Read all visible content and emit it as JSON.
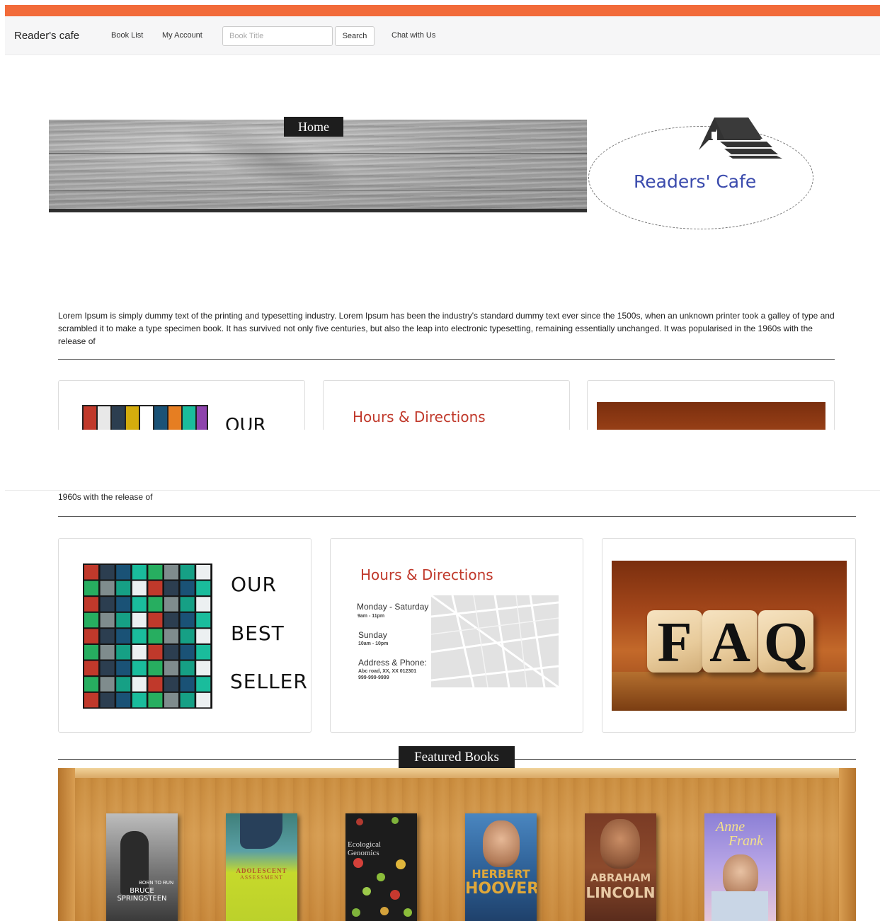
{
  "navbar": {
    "brand": "Reader's cafe",
    "links": {
      "book_list": "Book List",
      "my_account": "My Account",
      "chat": "Chat with Us"
    },
    "search": {
      "placeholder": "Book Title",
      "button": "Search"
    },
    "accent_color": "#f26b3a"
  },
  "hero": {
    "home_label": "Home",
    "logo_text": "Readers' Cafe"
  },
  "intro": {
    "text": "Lorem Ipsum is simply dummy text of the printing and typesetting industry. Lorem Ipsum has been the industry's standard dummy text ever since the 1500s, when an unknown printer took a galley of type and scrambled it to make a type specimen book. It has survived not only five centuries, but also the leap into electronic typesetting, remaining essentially unchanged. It was popularised in the 1960s with the release of",
    "repeated_line": "1960s with the release of"
  },
  "cards": {
    "best_seller": {
      "word1": "OUR",
      "word2": "BEST",
      "word3": "SELLER"
    },
    "hours": {
      "title": "Hours & Directions",
      "weekday_label": "Monday - Saturday",
      "weekday_hours": "9am - 11pm",
      "sunday_label": "Sunday",
      "sunday_hours": "10am - 10pm",
      "address_label": "Address & Phone:",
      "address": "Abc road, XX, XX 012301",
      "phone": "999-999-9999"
    },
    "faq": {
      "l1": "F",
      "l2": "A",
      "l3": "Q"
    }
  },
  "featured": {
    "label": "Featured Books",
    "books": [
      {
        "title": "BORN TO RUN",
        "subtitle": "BRUCE SPRINGSTEEN"
      },
      {
        "title": "ADOLESCENT",
        "subtitle": "ASSESSMENT"
      },
      {
        "title": "Ecological",
        "subtitle": "Genomics"
      },
      {
        "title": "HERBERT",
        "subtitle": "HOOVER"
      },
      {
        "title": "ABRAHAM",
        "subtitle": "LINCOLN"
      },
      {
        "title": "Anne",
        "subtitle": "Frank"
      }
    ]
  }
}
